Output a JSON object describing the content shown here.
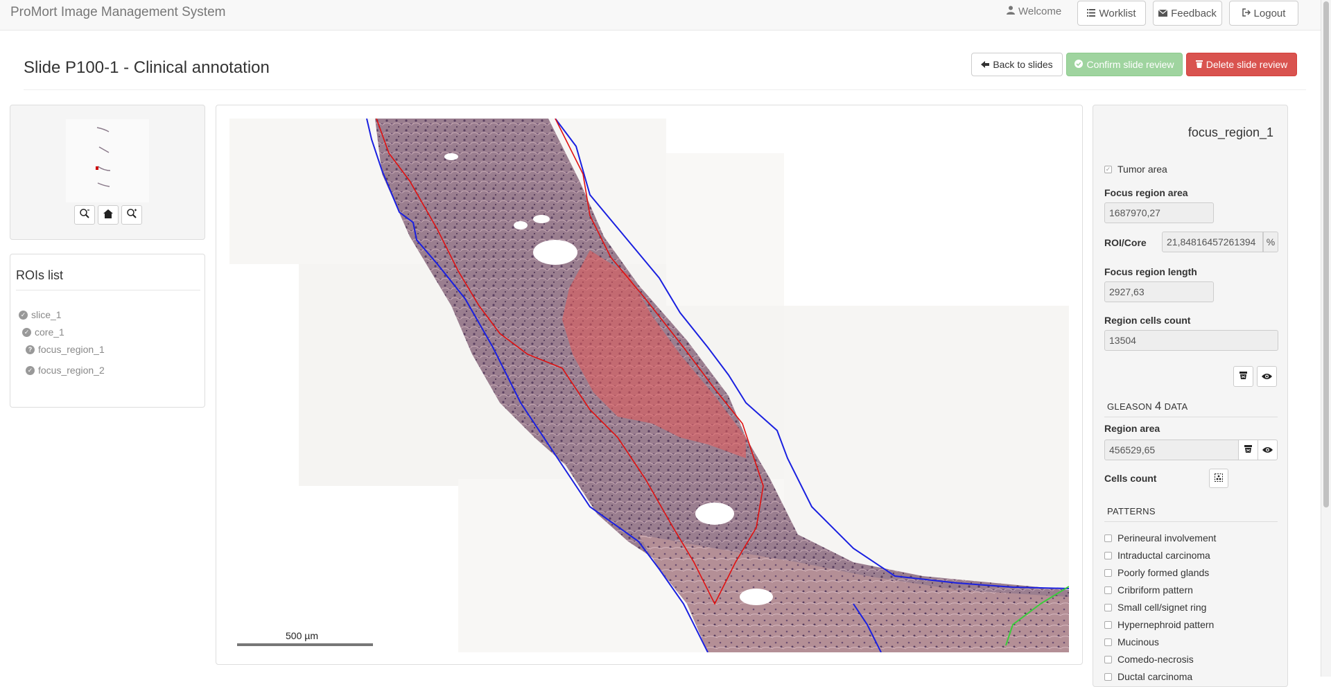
{
  "navbar": {
    "brand": "ProMort Image Management System",
    "welcome": "Welcome",
    "worklist": "Worklist",
    "feedback": "Feedback",
    "logout": "Logout"
  },
  "header": {
    "title": "Slide P100-1 - Clinical annotation",
    "back_label": "Back to slides",
    "confirm_label": "Confirm slide review",
    "delete_label": "Delete slide review"
  },
  "rois": {
    "title": "ROIs list",
    "items": [
      {
        "label": "slice_1",
        "status": "ok"
      },
      {
        "label": "core_1",
        "status": "ok"
      },
      {
        "label": "focus_region_1",
        "status": "pending"
      },
      {
        "label": "focus_region_2",
        "status": "ok"
      }
    ]
  },
  "viewer": {
    "scale_label": "500 µm"
  },
  "details": {
    "title": "focus_region_1",
    "tumor_area_label": "Tumor area",
    "tumor_area_checked": true,
    "area_label": "Focus region area",
    "area_value": "1687970,27",
    "roi_core_label": "ROI/Core",
    "roi_core_value": "21,84816457261394",
    "roi_core_unit": "%",
    "length_label": "Focus region length",
    "length_value": "2927,63",
    "cells_label": "Region cells count",
    "cells_value": "13504",
    "gleason_heading_prefix": "GLEASON",
    "gleason_grade": "4",
    "gleason_heading_suffix": "DATA",
    "region_area_label": "Region area",
    "region_area_value": "456529,65",
    "cells_count_label": "Cells count",
    "patterns_heading": "PATTERNS",
    "patterns": [
      "Perineural involvement",
      "Intraductal carcinoma",
      "Poorly formed glands",
      "Cribriform pattern",
      "Small cell/signet ring",
      "Hypernephroid pattern",
      "Mucinous",
      "Comedo-necrosis",
      "Ductal carcinoma"
    ]
  }
}
